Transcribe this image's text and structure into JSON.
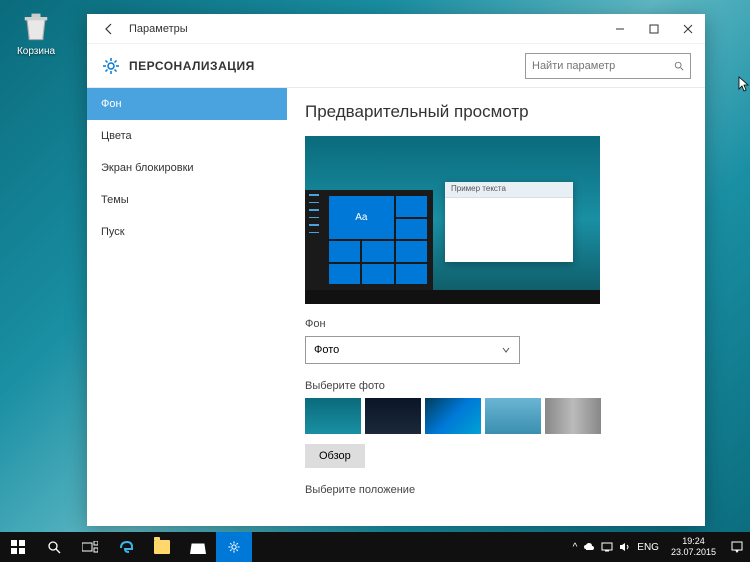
{
  "desktop": {
    "recycle_bin_label": "Корзина"
  },
  "window": {
    "title": "Параметры",
    "category": "ПЕРСОНАЛИЗАЦИЯ",
    "search_placeholder": "Найти параметр"
  },
  "sidebar": {
    "items": [
      {
        "label": "Фон",
        "active": true
      },
      {
        "label": "Цвета",
        "active": false
      },
      {
        "label": "Экран блокировки",
        "active": false
      },
      {
        "label": "Темы",
        "active": false
      },
      {
        "label": "Пуск",
        "active": false
      }
    ]
  },
  "content": {
    "preview_heading": "Предварительный просмотр",
    "sample_text": "Пример текста",
    "aa_text": "Aa",
    "background_label": "Фон",
    "background_dropdown_value": "Фото",
    "choose_photo_label": "Выберите фото",
    "browse_label": "Обзор",
    "choose_fit_label": "Выберите положение"
  },
  "taskbar": {
    "language": "ENG",
    "time": "19:24",
    "date": "23.07.2015"
  }
}
